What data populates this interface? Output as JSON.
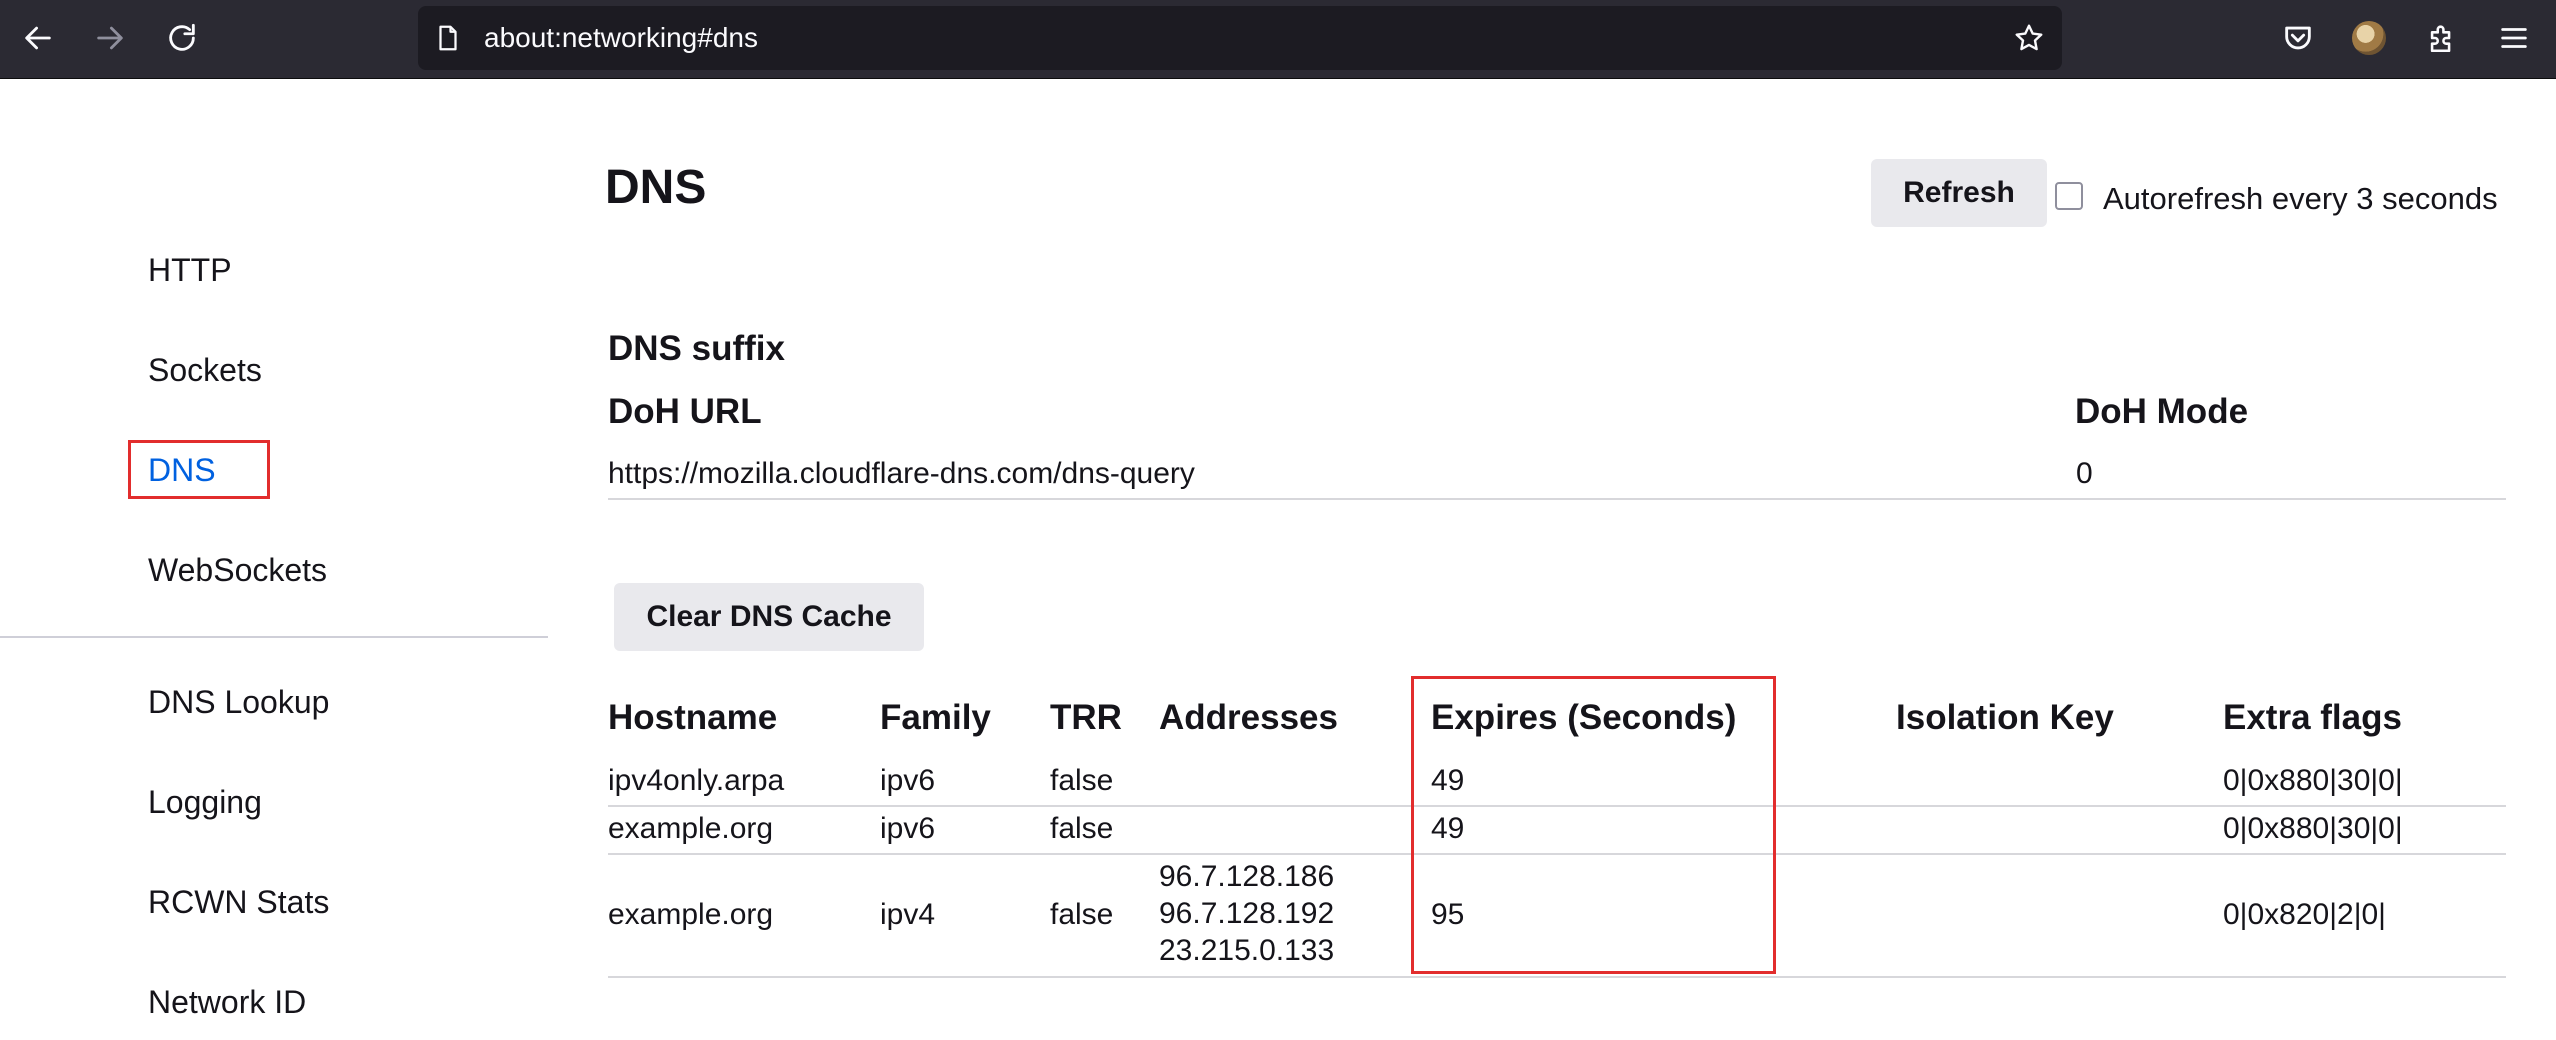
{
  "browser": {
    "url": "about:networking#dns",
    "colors": {
      "toolbar": "#2b2a33",
      "urlbar": "#1c1b22",
      "icon": "#fbfbfe",
      "disabled_icon": "#8f8f9d"
    },
    "icons": [
      "back-icon",
      "forward-icon",
      "reload-icon",
      "page-icon",
      "bookmark-star-icon",
      "pocket-icon",
      "avatar",
      "extensions-icon",
      "menu-icon"
    ]
  },
  "sidebar": {
    "items": [
      {
        "label": "HTTP"
      },
      {
        "label": "Sockets"
      },
      {
        "label": "DNS",
        "selected": true
      },
      {
        "label": "WebSockets"
      },
      {
        "label": "DNS Lookup"
      },
      {
        "label": "Logging"
      },
      {
        "label": "RCWN Stats"
      },
      {
        "label": "Network ID"
      }
    ],
    "selected_color": "#0061e0",
    "highlight_color": "#e22d2d"
  },
  "main": {
    "title": "DNS",
    "refresh_label": "Refresh",
    "autorefresh_label": "Autorefresh every 3 seconds",
    "autorefresh_checked": false,
    "dns_suffix_heading": "DNS suffix",
    "doh": {
      "url_header": "DoH URL",
      "mode_header": "DoH Mode",
      "url_value": "https://mozilla.cloudflare-dns.com/dns-query",
      "mode_value": "0"
    },
    "clear_cache_label": "Clear DNS Cache",
    "table": {
      "headers": [
        "Hostname",
        "Family",
        "TRR",
        "Addresses",
        "Expires (Seconds)",
        "Isolation Key",
        "Extra flags"
      ],
      "rows": [
        {
          "hostname": "ipv4only.arpa",
          "family": "ipv6",
          "trr": "false",
          "addresses": [],
          "expires": "49",
          "isolation_key": "",
          "extra_flags": "0|0x880|30|0|"
        },
        {
          "hostname": "example.org",
          "family": "ipv6",
          "trr": "false",
          "addresses": [],
          "expires": "49",
          "isolation_key": "",
          "extra_flags": "0|0x880|30|0|"
        },
        {
          "hostname": "example.org",
          "family": "ipv4",
          "trr": "false",
          "addresses": [
            "96.7.128.186",
            "96.7.128.192",
            "23.215.0.133"
          ],
          "expires": "95",
          "isolation_key": "",
          "extra_flags": "0|0x820|2|0|"
        }
      ]
    }
  }
}
